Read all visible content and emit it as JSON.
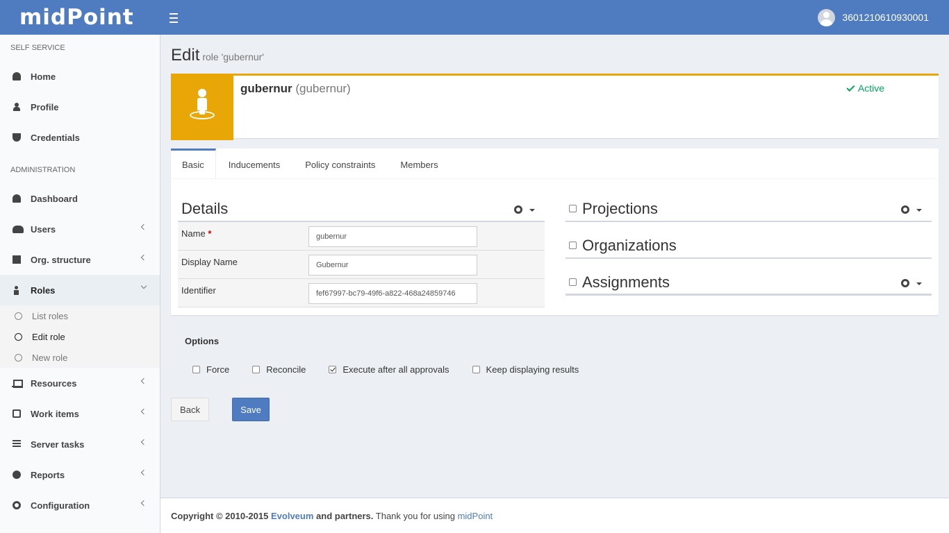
{
  "header": {
    "logo": "midPoint",
    "username": "3601210610930001"
  },
  "sidebar": {
    "self_service_header": "SELF SERVICE",
    "self_service": [
      {
        "label": "Home"
      },
      {
        "label": "Profile"
      },
      {
        "label": "Credentials"
      }
    ],
    "administration_header": "ADMINISTRATION",
    "administration": [
      {
        "label": "Dashboard"
      },
      {
        "label": "Users"
      },
      {
        "label": "Org. structure"
      },
      {
        "label": "Roles"
      },
      {
        "label": "Resources"
      },
      {
        "label": "Work items"
      },
      {
        "label": "Server tasks"
      },
      {
        "label": "Reports"
      },
      {
        "label": "Configuration"
      }
    ],
    "roles_sub": [
      {
        "label": "List roles"
      },
      {
        "label": "Edit role"
      },
      {
        "label": "New role"
      }
    ]
  },
  "page": {
    "title": "Edit",
    "subtitle": "role 'gubernur'"
  },
  "summary": {
    "name": "gubernur",
    "name_detail": "(gubernur)",
    "status": "Active",
    "accent_color": "#e8a706",
    "status_color": "#00a65a"
  },
  "tabs": [
    "Basic",
    "Inducements",
    "Policy constraints",
    "Members"
  ],
  "details": {
    "title": "Details",
    "fields": [
      {
        "label": "Name",
        "required": "*",
        "value": "gubernur"
      },
      {
        "label": "Display Name",
        "value": "Gubernur"
      },
      {
        "label": "Identifier",
        "value": "fef67997-bc79-49f6-a822-468a24859746"
      }
    ]
  },
  "right_panels": [
    {
      "title": "Projections"
    },
    {
      "title": "Organizations"
    },
    {
      "title": "Assignments"
    }
  ],
  "options": {
    "title": "Options",
    "items": [
      {
        "label": "Force",
        "checked": false
      },
      {
        "label": "Reconcile",
        "checked": false
      },
      {
        "label": "Execute after all approvals",
        "checked": true
      },
      {
        "label": "Keep displaying results",
        "checked": false
      }
    ]
  },
  "buttons": {
    "back": "Back",
    "save": "Save"
  },
  "footer": {
    "copyright": "Copyright © 2010-2015",
    "company": "Evolveum",
    "and_partners": "and partners.",
    "thanks": "Thank you for using",
    "product": "midPoint"
  },
  "colors": {
    "brand": "#4f7cc1"
  }
}
